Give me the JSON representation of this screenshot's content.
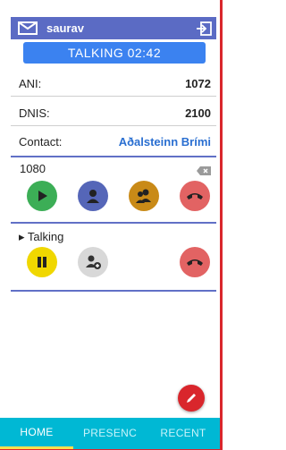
{
  "header": {
    "username": "saurav",
    "icons": [
      "mail-icon",
      "logout-icon"
    ]
  },
  "call": {
    "status": "TALKING 02:42"
  },
  "info": {
    "ani_label": "ANI:",
    "ani_value": "1072",
    "dnis_label": "DNIS:",
    "dnis_value": "2100",
    "contact_label": "Contact:",
    "contact_value": "Aðalsteinn Brími"
  },
  "dialer": {
    "number": "1080",
    "buttons": [
      "play-icon",
      "person-icon",
      "conference-icon",
      "hangup-icon"
    ]
  },
  "active_call": {
    "label": "▸ Talking",
    "buttons": [
      "pause-icon",
      "add-person-icon",
      "hangup-icon"
    ]
  },
  "fab": {
    "icon": "pencil-icon"
  },
  "nav": {
    "tabs": [
      "HOME",
      "PRESENC",
      "RECENT"
    ],
    "active": "HOME"
  },
  "colors": {
    "header": "#5b6bc4",
    "status": "#3b82f0",
    "nav": "#00b8d4",
    "accent": "#ffe14d",
    "fab": "#d9262c"
  }
}
